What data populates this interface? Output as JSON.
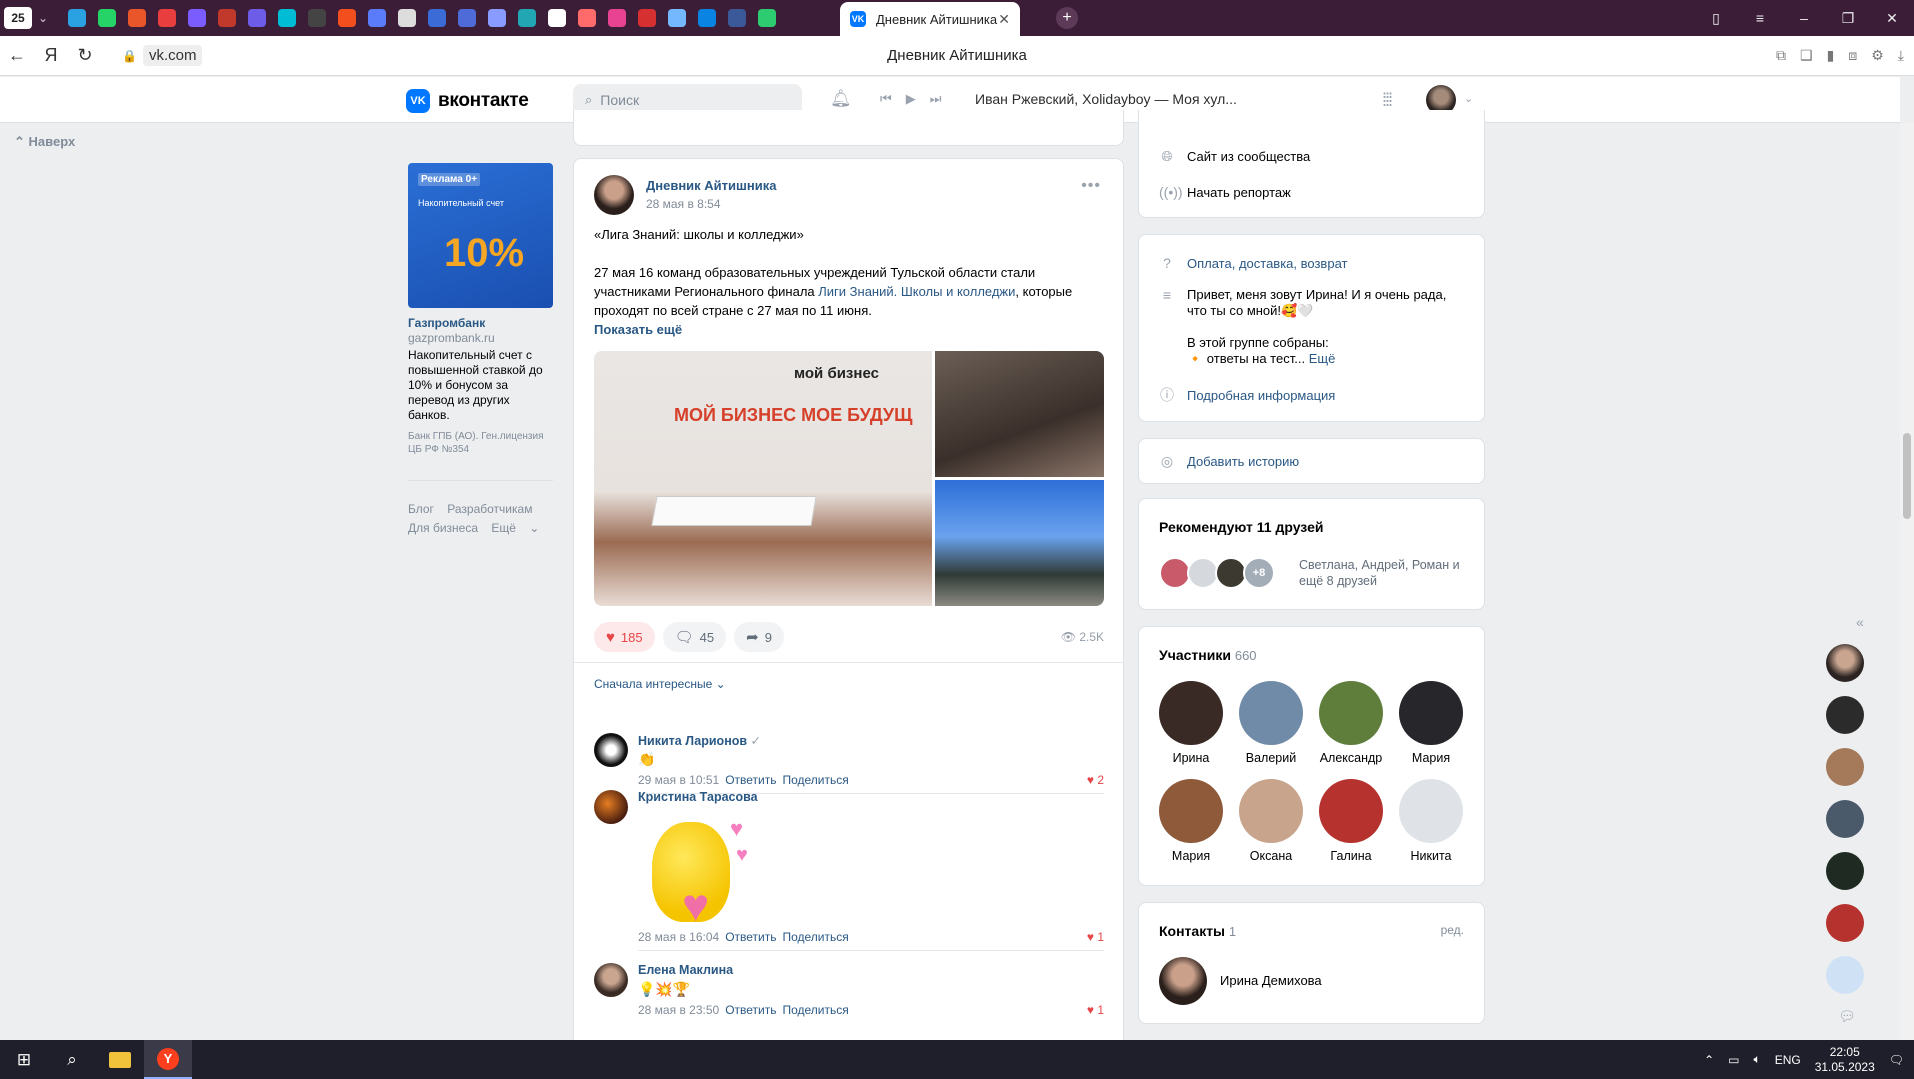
{
  "browser": {
    "tab_count": "25",
    "active_tab_title": "Дневник Айтишника",
    "url": "vk.com",
    "page_title": "Дневник Айтишника",
    "pinned_tab_colors": [
      "#2aa1e0",
      "#25d366",
      "#e8562a",
      "#e83e3e",
      "#7b5cff",
      "#c0392b",
      "#6c5ce7",
      "#00bcd4",
      "#444444",
      "#f24e1e",
      "#5b7cfa",
      "#dddddd",
      "#3b6bd6",
      "#4f6bd8",
      "#8a9bff",
      "#22a6b3",
      "#ffffff",
      "#ff6b6b",
      "#e84393",
      "#d63031",
      "#74b9ff",
      "#0984e3",
      "#3b5998",
      "#2ecc71"
    ]
  },
  "vk": {
    "logo_text": "вконтакте",
    "search_placeholder": "Поиск",
    "now_playing": "Иван Ржевский, Xolidayboy — Моя хул..."
  },
  "left": {
    "to_top": "Наверх",
    "ad": {
      "tag": "Реклама 0+",
      "image_caption": "Накопительный счет",
      "image_big": "10%",
      "brand": "Газпромбанк",
      "domain": "gazprombank.ru",
      "text": "Накопительный счет с повышенной ставкой до 10% и бонусом за перевод из других банков.",
      "legal": "Банк ГПБ (АО). Ген.лицензия ЦБ РФ №354"
    },
    "footer": {
      "blog": "Блог",
      "devs": "Разработчикам",
      "business": "Для бизнеса",
      "more": "Ещё"
    }
  },
  "post": {
    "author": "Дневник Айтишника",
    "date": "28 мая в 8:54",
    "title_line": "«Лига Знаний: школы и колледжи»",
    "body_before_link": "27 мая 16 команд образовательных учреждений Тульской области стали участниками Регионального финала ",
    "link_text": "Лиги Знаний. Школы и колледжи",
    "body_after_link": ", которые проходят по всей стране с 27 мая по 11 июня.",
    "show_more": "Показать ещё",
    "photo_banner": "МОЙ БИЗНЕС  МОЕ БУДУЩ",
    "photo_logo": "мой бизнес",
    "likes": "185",
    "comments": "45",
    "shares": "9",
    "views": "2.5K",
    "sort_label": "Сначала интересные"
  },
  "comments": [
    {
      "name": "Никита Ларионов",
      "body": "👏",
      "date": "29 мая в 10:51",
      "reply": "Ответить",
      "share": "Поделиться",
      "likes": "2",
      "verified": "✓"
    },
    {
      "name": "Кристина Тарасова",
      "body": "",
      "date": "28 мая в 16:04",
      "reply": "Ответить",
      "share": "Поделиться",
      "likes": "1"
    },
    {
      "name": "Елена Маклина",
      "body": "💡💥🏆",
      "date": "28 мая в 23:50",
      "reply": "Ответить",
      "share": "Поделиться",
      "likes": "1"
    }
  ],
  "right": {
    "site_from_community": "Сайт из сообщества",
    "start_stream": "Начать репортаж",
    "payment_link": "Оплата, доставка, возврат",
    "description_line1": "Привет, меня зовут Ирина! И я очень рада, что ты со мной!🥰🤍",
    "description_line2": "В этой группе собраны:",
    "description_line3": "🔸 ответы на тест...",
    "description_more": "Ещё",
    "more_info": "Подробная информация",
    "add_story": "Добавить историю",
    "recommend_title": "Рекомендуют 11 друзей",
    "recommend_plus": "+8",
    "recommend_text": "Светлана, Андрей, Роман и ещё 8 друзей",
    "members_title": "Участники",
    "members_count": "660",
    "members": [
      {
        "name": "Ирина",
        "color": "#3a2a26"
      },
      {
        "name": "Валерий",
        "color": "#6f8ba8"
      },
      {
        "name": "Александр",
        "color": "#5f7e3c"
      },
      {
        "name": "Мария",
        "color": "#26262b"
      },
      {
        "name": "Мария",
        "color": "#8e5a3a"
      },
      {
        "name": "Оксана",
        "color": "#c9a48c"
      },
      {
        "name": "Галина",
        "color": "#b5322e"
      },
      {
        "name": "Никита",
        "color": "#dfe3e8"
      }
    ],
    "contacts_title": "Контакты",
    "contacts_count": "1",
    "contacts_edit": "ред.",
    "contact_name": "Ирина Демихова"
  },
  "taskbar": {
    "lang": "ENG",
    "time": "22:05",
    "date": "31.05.2023"
  }
}
